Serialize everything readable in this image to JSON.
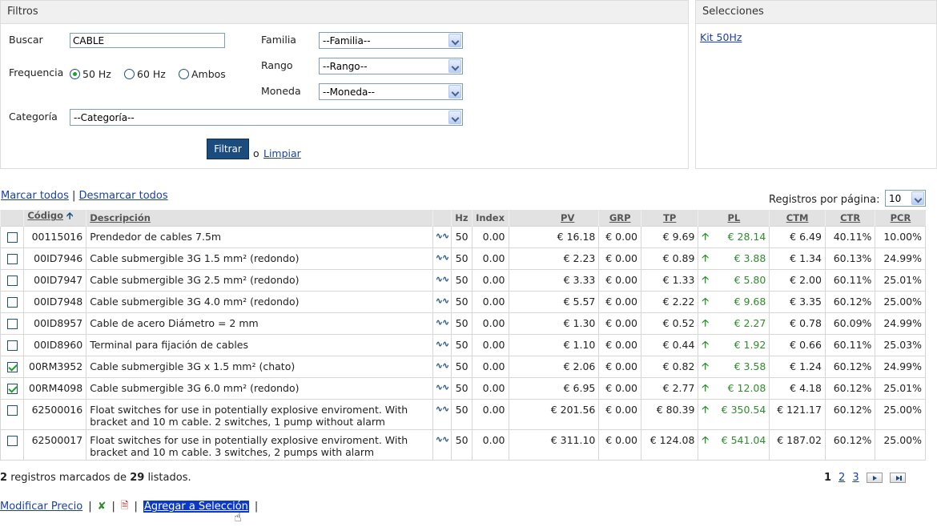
{
  "filters": {
    "title": "Filtros",
    "buscar_label": "Buscar",
    "buscar_value": "CABLE",
    "familia_label": "Familia",
    "familia_value": "--Familia--",
    "rango_label": "Rango",
    "rango_value": "--Rango--",
    "moneda_label": "Moneda",
    "moneda_value": "--Moneda--",
    "frequencia_label": "Frequencia",
    "freq_options": [
      "50 Hz",
      "60 Hz",
      "Ambos"
    ],
    "freq_selected": "50 Hz",
    "categoria_label": "Categoría",
    "categoria_value": "--Categoría--",
    "filter_button": "Filtrar",
    "or_text": "o",
    "clear_link": "Limpiar"
  },
  "selections": {
    "title": "Selecciones",
    "items": [
      "Kit 50Hz"
    ]
  },
  "bulk": {
    "mark_all": "Marcar todos",
    "separator": "|",
    "unmark_all": "Desmarcar todos",
    "per_page_label": "Registros por página:",
    "per_page_value": "10"
  },
  "table": {
    "columns": {
      "codigo": "Código",
      "descripcion": "Descripción",
      "hz": "Hz",
      "index": "Index",
      "pv": "PV",
      "grp": "GRP",
      "tp": "TP",
      "pl": "PL",
      "ctm": "CTM",
      "ctr": "CTR",
      "pcr": "PCR"
    },
    "rows": [
      {
        "checked": false,
        "codigo": "00115016",
        "descripcion": "Prendedor de cables 7.5m",
        "hz": "50",
        "index": "0.00",
        "pv": "€ 16.18",
        "grp": "€ 0.00",
        "tp": "€ 9.69",
        "pl": "€ 28.14",
        "ctm": "€ 6.49",
        "ctr": "40.11%",
        "pcr": "10.00%"
      },
      {
        "checked": false,
        "codigo": "00ID7946",
        "descripcion": "Cable submergible 3G 1.5 mm² (redondo)",
        "hz": "50",
        "index": "0.00",
        "pv": "€ 2.23",
        "grp": "€ 0.00",
        "tp": "€ 0.89",
        "pl": "€ 3.88",
        "ctm": "€ 1.34",
        "ctr": "60.13%",
        "pcr": "24.99%"
      },
      {
        "checked": false,
        "codigo": "00ID7947",
        "descripcion": "Cable submergible 3G 2.5 mm² (redondo)",
        "hz": "50",
        "index": "0.00",
        "pv": "€ 3.33",
        "grp": "€ 0.00",
        "tp": "€ 1.33",
        "pl": "€ 5.80",
        "ctm": "€ 2.00",
        "ctr": "60.11%",
        "pcr": "25.01%"
      },
      {
        "checked": false,
        "codigo": "00ID7948",
        "descripcion": "Cable submergible 3G 4.0 mm² (redondo)",
        "hz": "50",
        "index": "0.00",
        "pv": "€ 5.57",
        "grp": "€ 0.00",
        "tp": "€ 2.22",
        "pl": "€ 9.68",
        "ctm": "€ 3.35",
        "ctr": "60.12%",
        "pcr": "25.00%"
      },
      {
        "checked": false,
        "codigo": "00ID8957",
        "descripcion": "Cable de acero Diámetro = 2 mm",
        "hz": "50",
        "index": "0.00",
        "pv": "€ 1.30",
        "grp": "€ 0.00",
        "tp": "€ 0.52",
        "pl": "€ 2.27",
        "ctm": "€ 0.78",
        "ctr": "60.09%",
        "pcr": "24.99%"
      },
      {
        "checked": false,
        "codigo": "00ID8960",
        "descripcion": "Terminal para fijación de cables",
        "hz": "50",
        "index": "0.00",
        "pv": "€ 1.10",
        "grp": "€ 0.00",
        "tp": "€ 0.44",
        "pl": "€ 1.92",
        "ctm": "€ 0.66",
        "ctr": "60.11%",
        "pcr": "25.03%"
      },
      {
        "checked": true,
        "codigo": "00RM3952",
        "descripcion": "Cable submergible 3G x 1.5 mm² (chato)",
        "hz": "50",
        "index": "0.00",
        "pv": "€ 2.06",
        "grp": "€ 0.00",
        "tp": "€ 0.82",
        "pl": "€ 3.58",
        "ctm": "€ 1.24",
        "ctr": "60.12%",
        "pcr": "24.99%"
      },
      {
        "checked": true,
        "codigo": "00RM4098",
        "descripcion": "Cable submergible 3G 6.0 mm² (redondo)",
        "hz": "50",
        "index": "0.00",
        "pv": "€ 6.95",
        "grp": "€ 0.00",
        "tp": "€ 2.77",
        "pl": "€ 12.08",
        "ctm": "€ 4.18",
        "ctr": "60.12%",
        "pcr": "25.01%"
      },
      {
        "checked": false,
        "codigo": "62500016",
        "descripcion": "Float switches for use in potentially explosive enviroment. With bracket and 10 m cable. 2 switches, 1 pump without alarm",
        "hz": "50",
        "index": "0.00",
        "pv": "€ 201.56",
        "grp": "€ 0.00",
        "tp": "€ 80.39",
        "pl": "€ 350.54",
        "ctm": "€ 121.17",
        "ctr": "60.12%",
        "pcr": "25.00%"
      },
      {
        "checked": false,
        "codigo": "62500017",
        "descripcion": "Float switches for use in potentially explosive enviroment. With bracket and 10 m cable. 3 switches, 2 pumps with alarm",
        "hz": "50",
        "index": "0.00",
        "pv": "€ 311.10",
        "grp": "€ 0.00",
        "tp": "€ 124.08",
        "pl": "€ 541.04",
        "ctm": "€ 187.02",
        "ctr": "60.12%",
        "pcr": "25.00%"
      }
    ]
  },
  "summary": {
    "marked_count": "2",
    "text_middle": "registros marcados de",
    "total_count": "29",
    "text_end": "listados."
  },
  "pagination": {
    "current": "1",
    "pages": [
      "2",
      "3"
    ]
  },
  "actions": {
    "modify_price": "Modificar Precio",
    "separator": "|",
    "add_to_selection": "Agregar a Selección"
  },
  "colors": {
    "accent_button": "#1b4c7e",
    "link": "#1a3fa8",
    "positive": "#2e8b2e",
    "selected_highlight": "#0a39c7"
  }
}
